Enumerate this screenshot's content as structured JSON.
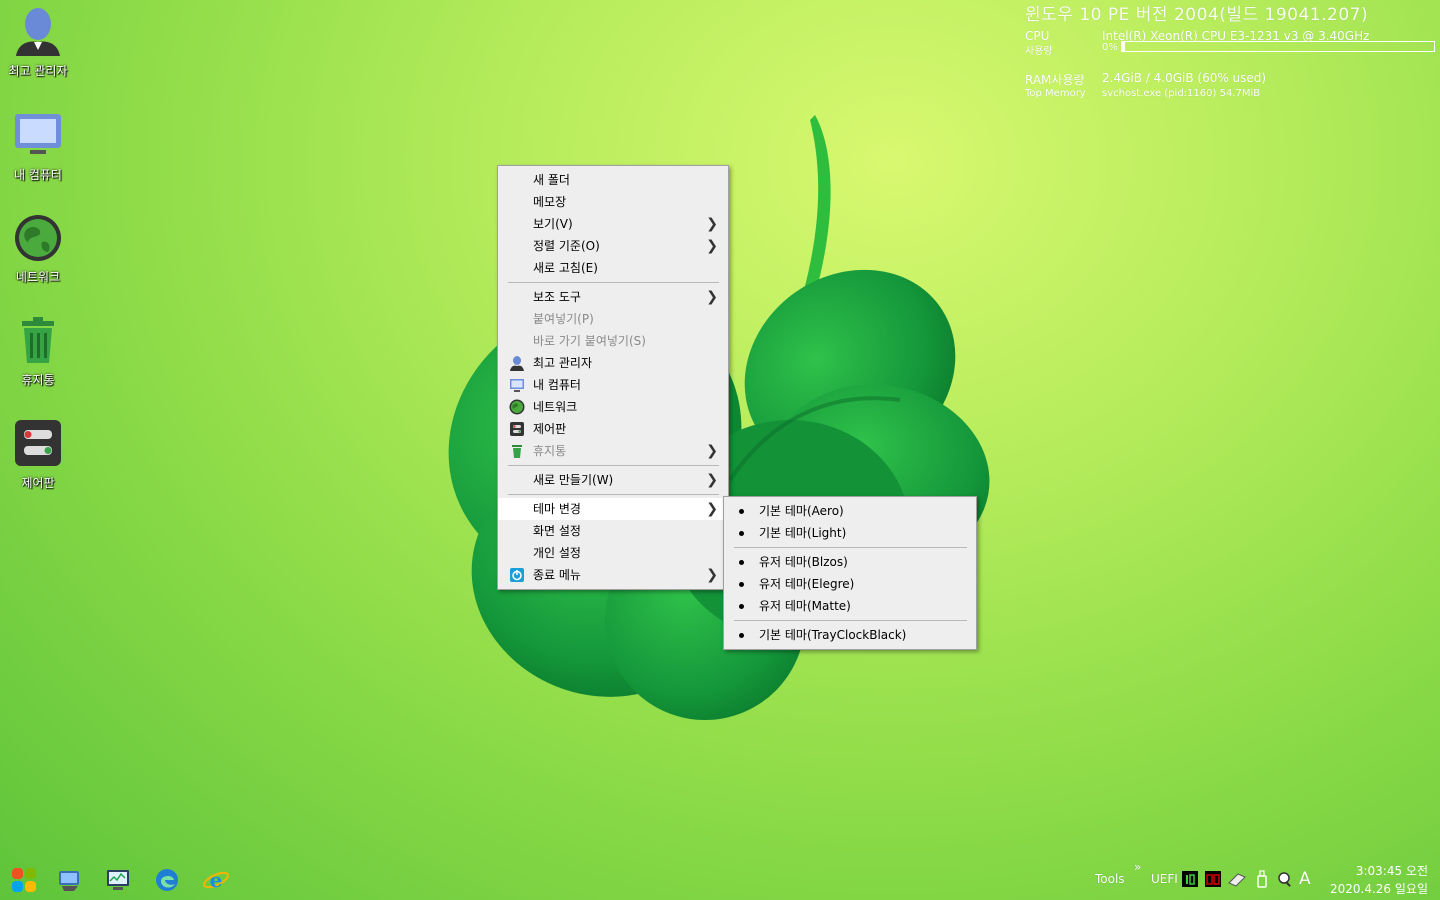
{
  "desktop": {
    "icons": [
      {
        "label": "최고 관리자",
        "icon": "admin-user-icon"
      },
      {
        "label": "내 컴퓨터",
        "icon": "monitor-icon"
      },
      {
        "label": "네트워크",
        "icon": "globe-icon"
      },
      {
        "label": "휴지통",
        "icon": "trash-icon"
      },
      {
        "label": "제어판",
        "icon": "control-panel-icon"
      }
    ]
  },
  "sysinfo": {
    "title": "윈도우 10 PE   버전 2004(빌드 19041.207)",
    "cpu_label": "CPU",
    "cpu_name": "Intel(R) Xeon(R) CPU E3-1231 v3 @ 3.40GHz",
    "usage_label": "사용량",
    "usage_value": "0%",
    "usage_fraction": 0.01,
    "ram_label": "RAM사용량",
    "ram_value": "2.4GiB / 4.0GiB (60% used)",
    "top_memory_label": "Top Memory",
    "top_memory_value": "svchost.exe (pid:1160) 54.7MiB"
  },
  "context_menu": {
    "new_folder": "새 폴더",
    "notepad": "메모장",
    "view": "보기(V)",
    "sort_by": "정렬 기준(O)",
    "refresh": "새로 고침(E)",
    "accessories": "보조 도구",
    "paste": "붙여넣기(P)",
    "paste_shortcut": "바로 가기 붙여넣기(S)",
    "admin": "최고 관리자",
    "my_computer": "내 컴퓨터",
    "network": "네트워크",
    "control_panel": "제어판",
    "recycle_bin": "휴지통",
    "new": "새로 만들기(W)",
    "change_theme": "테마 변경",
    "display_settings": "화면 설정",
    "personalize": "개인 설정",
    "shutdown_menu": "종료 메뉴"
  },
  "theme_submenu": {
    "aero": "기본 테마(Aero)",
    "light": "기본 테마(Light)",
    "blzos": "유저 테마(Blzos)",
    "elegre": "유저 테마(Elegre)",
    "matte": "유저 테마(Matte)",
    "trayclock": "기본 테마(TrayClockBlack)"
  },
  "taskbar": {
    "tools_label": "Tools",
    "chevron": "»",
    "uefi_label": "UEFI",
    "ime_label": "A",
    "clock_time": "3:03:45 오전",
    "clock_date": "2020.4.26 일요일"
  },
  "colors": {
    "accent_red": "#d40000",
    "menu_bg": "#eeeeee",
    "clover_green": "#22a83a"
  }
}
